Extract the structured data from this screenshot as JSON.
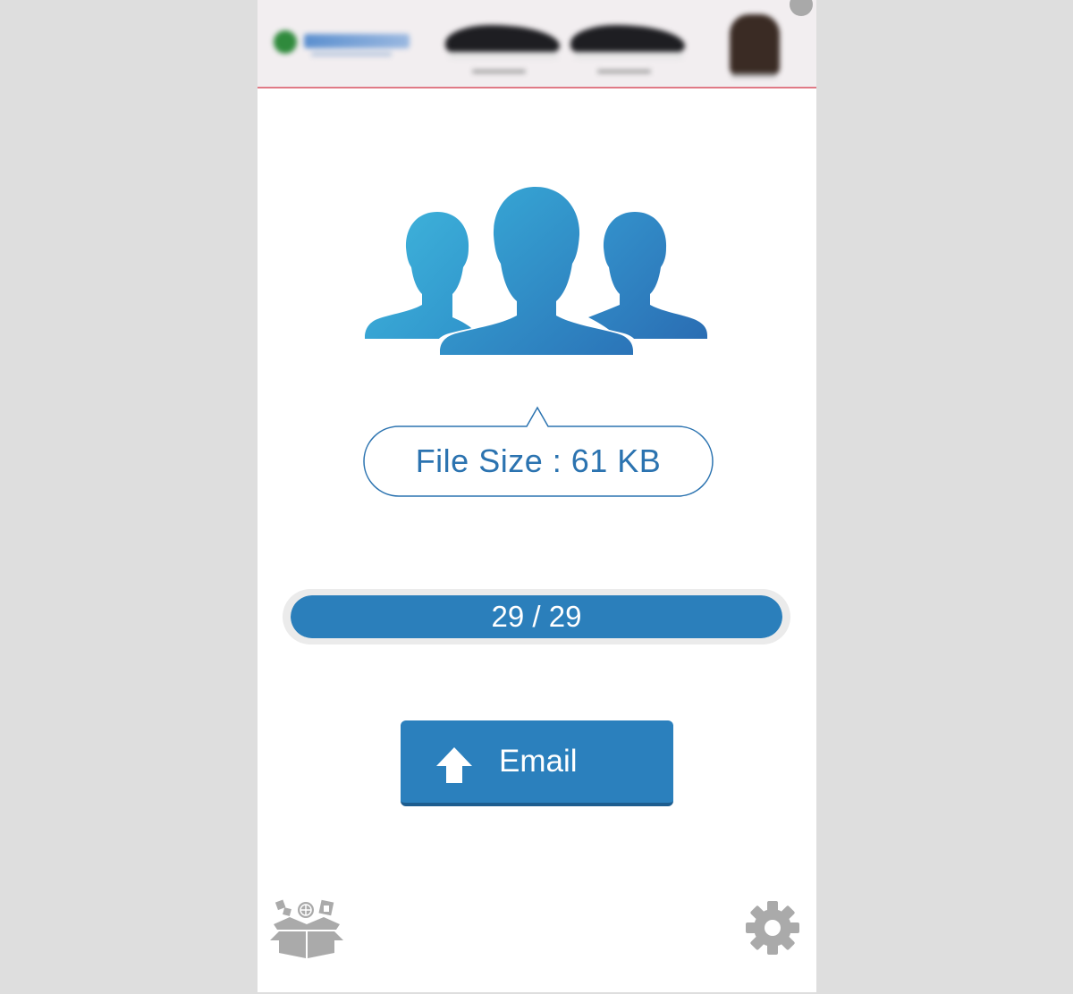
{
  "ad": {
    "label": "advertisement-banner"
  },
  "export": {
    "file_size_text": "File Size : 61 KB",
    "progress_text": "29 / 29",
    "progress_current": 29,
    "progress_total": 29,
    "email_button_label": "Email"
  },
  "icons": {
    "contacts": "contacts-group-icon",
    "upload": "upload-arrow-icon",
    "apps": "apps-box-icon",
    "settings": "settings-gear-icon"
  },
  "colors": {
    "accent": "#2b80bd",
    "text_accent": "#2b73b0",
    "icon_gray": "#aaaaaa"
  }
}
